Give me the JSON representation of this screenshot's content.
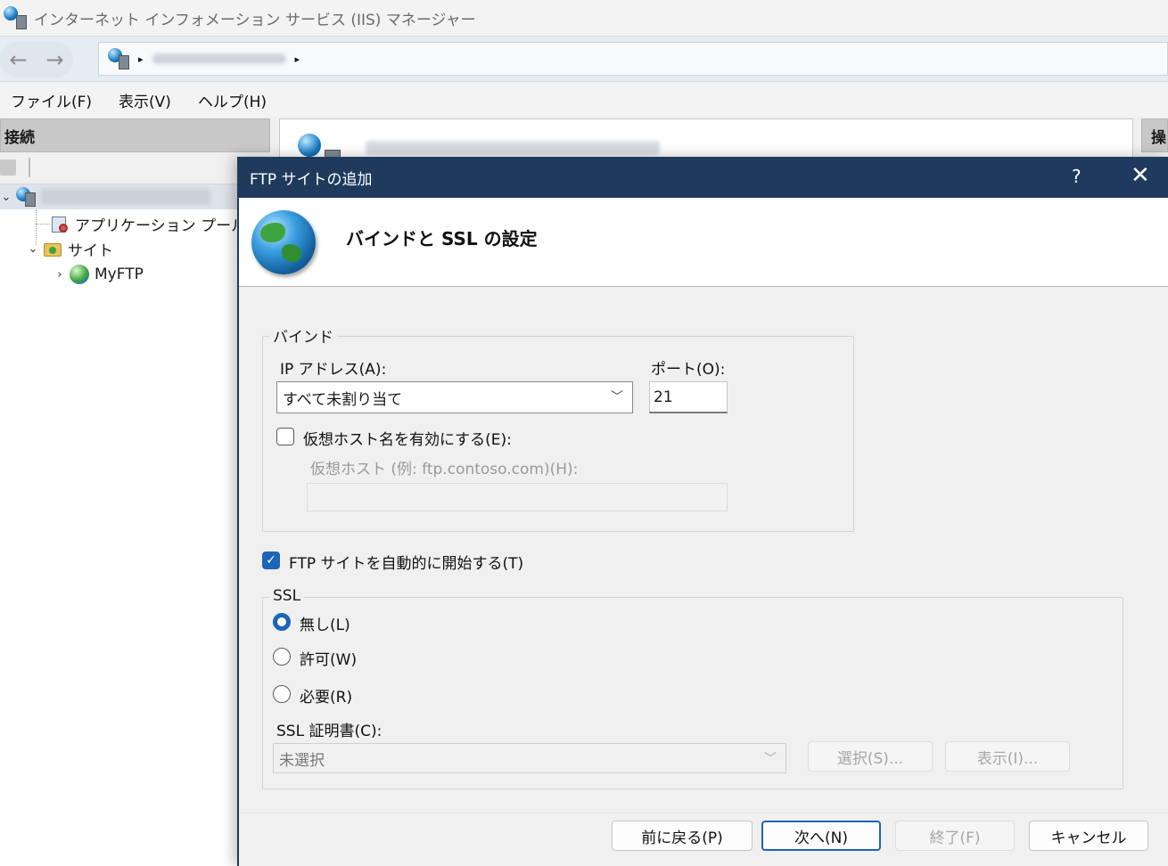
{
  "window": {
    "title": "インターネット インフォメーション サービス (IIS) マネージャー"
  },
  "navigation": {
    "back_icon": "←",
    "forward_icon": "→",
    "separator": "▸"
  },
  "menu": [
    "ファイル(F)",
    "表示(V)",
    "ヘルプ(H)"
  ],
  "connections": {
    "header": "接続",
    "tree": [
      {
        "label": "アプリケーション プール",
        "icon": "app-pool-icon"
      },
      {
        "label": "サイト",
        "icon": "sites-folder-icon",
        "toggle": "⌄"
      },
      {
        "label": "MyFTP",
        "icon": "globe-icon",
        "toggle": "›"
      }
    ]
  },
  "actions": {
    "header": "操"
  },
  "dialog": {
    "title": "FTP サイトの追加",
    "help": "?",
    "close": "✕",
    "heading": "バインドと SSL の設定",
    "binding": {
      "group_label": "バインド",
      "ip_label": "IP アドレス(A):",
      "ip_value": "すべて未割り当て",
      "port_label": "ポート(O):",
      "port_value": "21",
      "virtual_host_check_label": "仮想ホスト名を有効にする(E):",
      "virtual_host_checked": false,
      "virtual_host_label": "仮想ホスト (例: ftp.contoso.com)(H):",
      "virtual_host_value": ""
    },
    "auto_start": {
      "label": "FTP サイトを自動的に開始する(T)",
      "checked": true
    },
    "ssl": {
      "group_label": "SSL",
      "options": [
        {
          "label": "無し(L)",
          "selected": true
        },
        {
          "label": "許可(W)",
          "selected": false
        },
        {
          "label": "必要(R)",
          "selected": false
        }
      ],
      "cert_label": "SSL 証明書(C):",
      "cert_value": "未選択",
      "select_button": "選択(S)...",
      "view_button": "表示(I)..."
    },
    "buttons": {
      "back": "前に戻る(P)",
      "next": "次へ(N)",
      "finish": "終了(F)",
      "cancel": "キャンセル"
    }
  },
  "colors": {
    "dialog_title_bg": "#1f3a5c",
    "accent": "#1c65b8"
  }
}
